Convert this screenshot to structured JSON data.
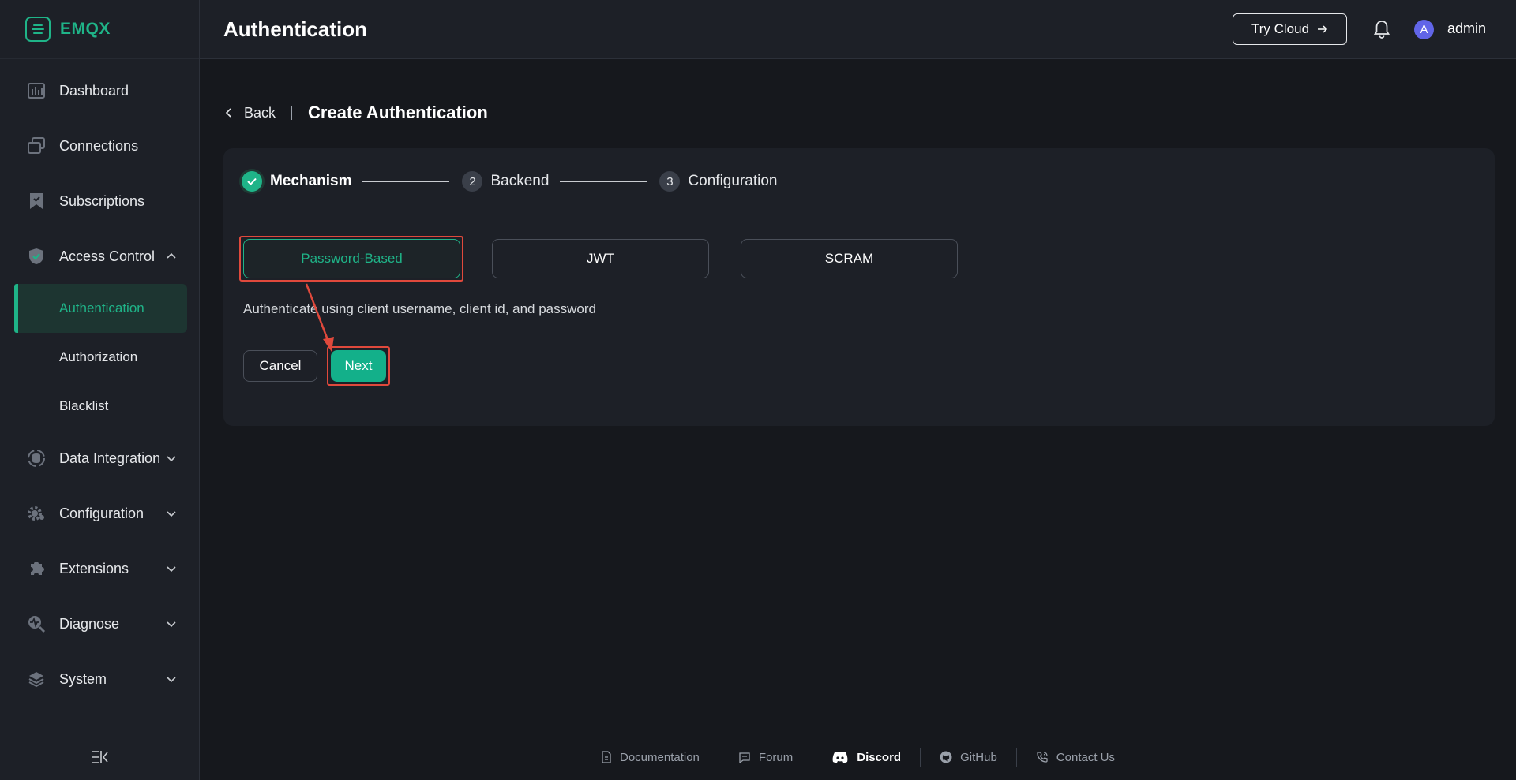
{
  "brand": {
    "name": "EMQX",
    "accent": "#1fb488"
  },
  "header": {
    "title": "Authentication",
    "try_cloud_label": "Try Cloud",
    "avatar_letter": "A",
    "username": "admin"
  },
  "sidebar": {
    "items": [
      {
        "label": "Dashboard",
        "icon": "dashboard-icon"
      },
      {
        "label": "Connections",
        "icon": "connections-icon"
      },
      {
        "label": "Subscriptions",
        "icon": "subscriptions-icon"
      },
      {
        "label": "Access Control",
        "icon": "shield-icon",
        "expanded": true,
        "children": [
          {
            "label": "Authentication",
            "active": true
          },
          {
            "label": "Authorization"
          },
          {
            "label": "Blacklist"
          }
        ]
      },
      {
        "label": "Data Integration",
        "icon": "data-integration-icon"
      },
      {
        "label": "Configuration",
        "icon": "gear-icon"
      },
      {
        "label": "Extensions",
        "icon": "puzzle-icon"
      },
      {
        "label": "Diagnose",
        "icon": "diagnose-icon"
      },
      {
        "label": "System",
        "icon": "layers-icon"
      }
    ]
  },
  "breadcrumb": {
    "back_label": "Back",
    "title": "Create Authentication"
  },
  "steps": [
    {
      "number": "1",
      "label": "Mechanism",
      "status": "done"
    },
    {
      "number": "2",
      "label": "Backend",
      "status": "todo"
    },
    {
      "number": "3",
      "label": "Configuration",
      "status": "todo"
    }
  ],
  "mechanisms": {
    "options": [
      "Password-Based",
      "JWT",
      "SCRAM"
    ],
    "selected": "Password-Based",
    "description": "Authenticate using client username, client id, and password"
  },
  "actions": {
    "cancel_label": "Cancel",
    "next_label": "Next"
  },
  "footer": {
    "links": [
      {
        "label": "Documentation",
        "icon": "document-icon"
      },
      {
        "label": "Forum",
        "icon": "chat-icon"
      },
      {
        "label": "Discord",
        "icon": "discord-icon"
      },
      {
        "label": "GitHub",
        "icon": "github-icon"
      },
      {
        "label": "Contact Us",
        "icon": "phone-icon"
      }
    ]
  }
}
